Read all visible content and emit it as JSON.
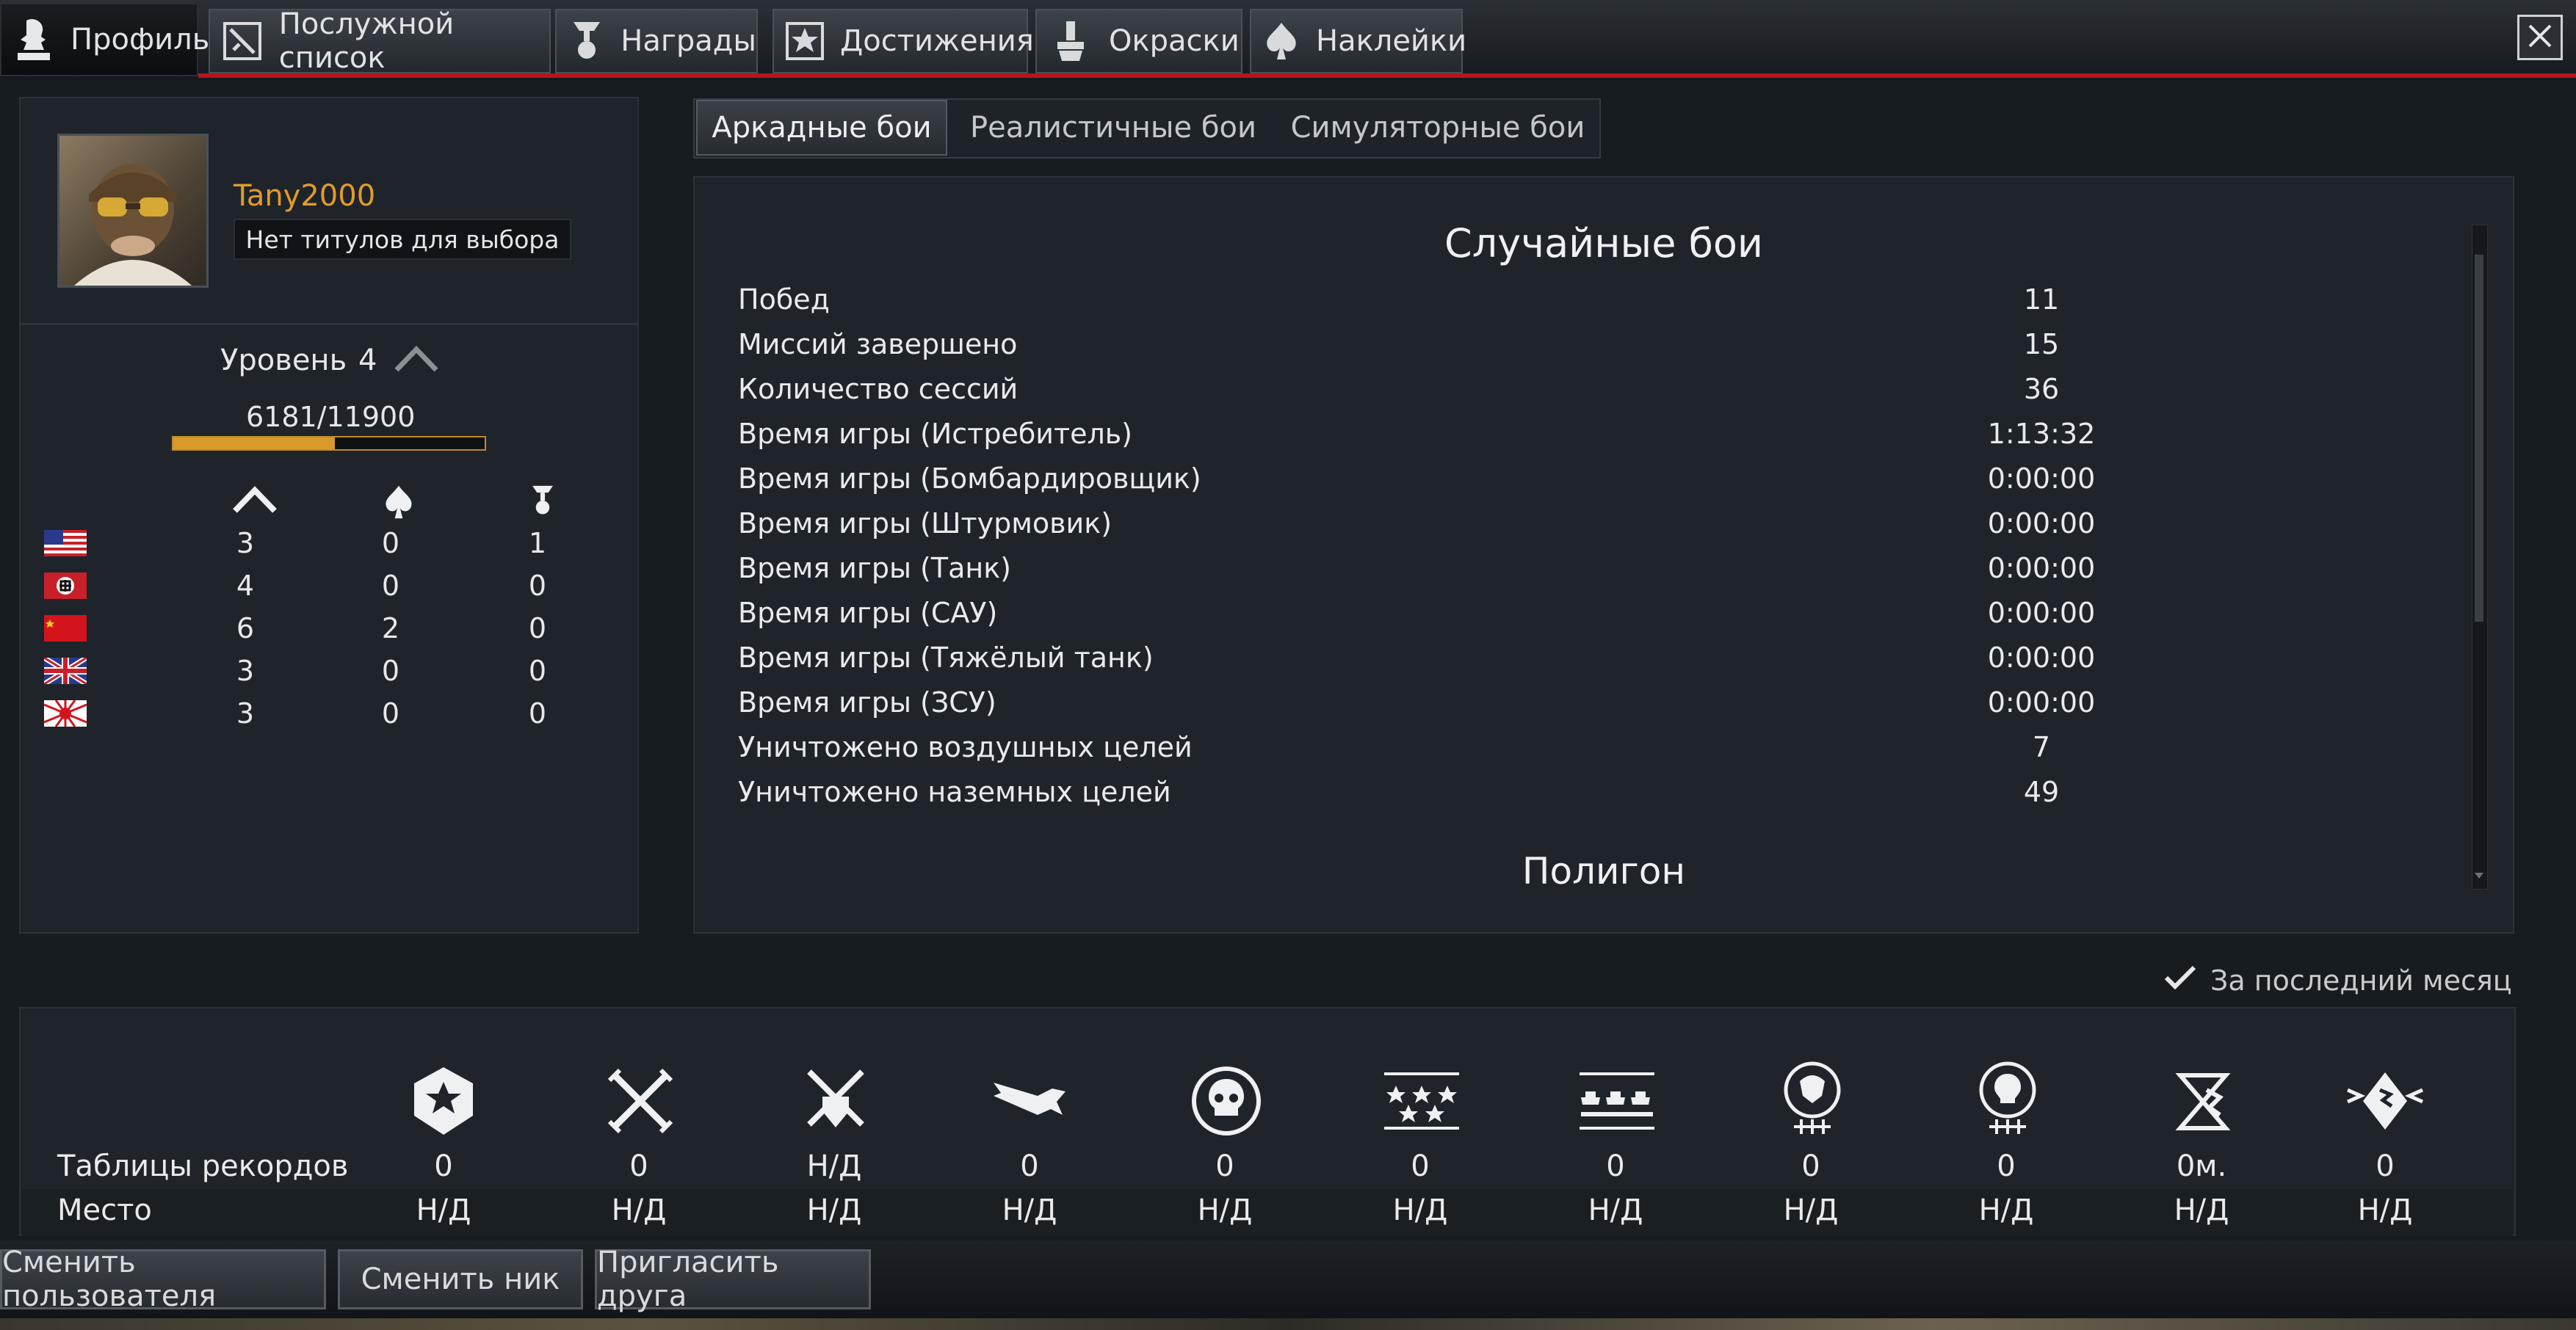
{
  "tabs": [
    {
      "label": "Профиль",
      "icon": "profile-bust-icon",
      "active": true
    },
    {
      "label": "Послужной список",
      "icon": "service-record-icon"
    },
    {
      "label": "Награды",
      "icon": "medal-icon"
    },
    {
      "label": "Достижения",
      "icon": "star-icon"
    },
    {
      "label": "Окраски",
      "icon": "paint-brush-icon"
    },
    {
      "label": "Наклейки",
      "icon": "spade-icon"
    }
  ],
  "close_icon": "close-icon",
  "profile": {
    "nickname": "Tany2000",
    "title_select": "Нет титулов для выбора",
    "level_label": "Уровень",
    "level_value": "4",
    "xp_text": "6181/11900",
    "xp_progress": 0.52
  },
  "nation_table": {
    "column_icons": [
      "chevron-up-icon",
      "spade-icon",
      "medal-icon"
    ],
    "rows": [
      {
        "flag": "usa-flag-icon",
        "values": [
          "3",
          "0",
          "1"
        ]
      },
      {
        "flag": "germany-flag-icon",
        "values": [
          "4",
          "0",
          "0"
        ]
      },
      {
        "flag": "ussr-flag-icon",
        "values": [
          "6",
          "2",
          "0"
        ]
      },
      {
        "flag": "uk-flag-icon",
        "values": [
          "3",
          "0",
          "0"
        ]
      },
      {
        "flag": "japan-flag-icon",
        "values": [
          "3",
          "0",
          "0"
        ]
      }
    ]
  },
  "mode_tabs": [
    {
      "label": "Аркадные бои",
      "active": true
    },
    {
      "label": "Реалистичные бои"
    },
    {
      "label": "Симуляторные бои"
    }
  ],
  "stats": {
    "section_title": "Случайные бои",
    "rows": [
      {
        "label": "Побед",
        "value": "11"
      },
      {
        "label": "Миссий завершено",
        "value": "15"
      },
      {
        "label": "Количество сессий",
        "value": "36"
      },
      {
        "label": "Время игры (Истребитель)",
        "value": "1:13:32"
      },
      {
        "label": "Время игры (Бомбардировщик)",
        "value": "0:00:00"
      },
      {
        "label": "Время игры (Штурмовик)",
        "value": "0:00:00"
      },
      {
        "label": "Время игры (Танк)",
        "value": "0:00:00"
      },
      {
        "label": "Время игры (САУ)",
        "value": "0:00:00"
      },
      {
        "label": "Время игры (Тяжёлый танк)",
        "value": "0:00:00"
      },
      {
        "label": "Время игры (ЗСУ)",
        "value": "0:00:00"
      },
      {
        "label": "Уничтожено воздушных целей",
        "value": "7"
      },
      {
        "label": "Уничтожено наземных целей",
        "value": "49"
      }
    ],
    "next_section_title": "Полигон"
  },
  "last_month_label": "За последний месяц",
  "records": {
    "row_labels": [
      "Таблицы рекордов",
      "Место"
    ],
    "columns": [
      {
        "icon": "victory-star-icon",
        "record": "0",
        "place": "Н/Д"
      },
      {
        "icon": "crossed-swords-icon",
        "record": "0",
        "place": "Н/Д"
      },
      {
        "icon": "swords-shield-icon",
        "record": "Н/Д",
        "place": "Н/Д"
      },
      {
        "icon": "aircraft-icon",
        "record": "0",
        "place": "Н/Д"
      },
      {
        "icon": "skull-icon",
        "record": "0",
        "place": "Н/Д"
      },
      {
        "icon": "five-stars-icon",
        "record": "0",
        "place": "Н/Д"
      },
      {
        "icon": "tanks-row-icon",
        "record": "0",
        "place": "Н/Д"
      },
      {
        "icon": "lion-emblem-icon",
        "record": "0",
        "place": "Н/Д"
      },
      {
        "icon": "lightbulb-emblem-icon",
        "record": "0",
        "place": "Н/Д"
      },
      {
        "icon": "hourglass-icon",
        "record": "0м.",
        "place": "Н/Д"
      },
      {
        "icon": "winged-diamond-icon",
        "record": "0",
        "place": "Н/Д"
      }
    ]
  },
  "bottom_buttons": [
    "Сменить пользователя",
    "Сменить ник",
    "Пригласить друга"
  ]
}
